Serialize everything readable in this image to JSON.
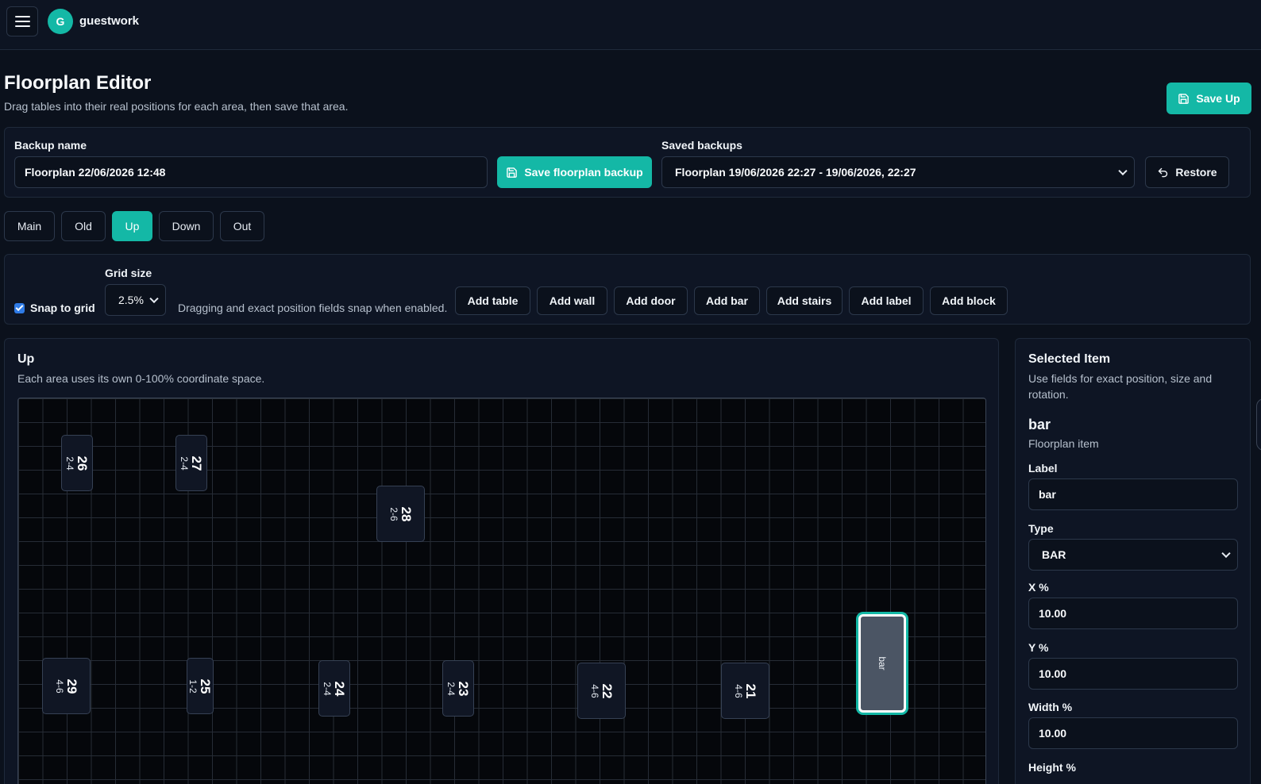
{
  "app": {
    "brand_initial": "G",
    "brand_name": "guestwork"
  },
  "header": {
    "title": "Floorplan Editor",
    "subtitle": "Drag tables into their real positions for each area, then save that area.",
    "save_area_label": "Save Up"
  },
  "backup": {
    "name_label": "Backup name",
    "name_value": "Floorplan 22/06/2026 12:48",
    "save_label": "Save floorplan backup",
    "saved_label": "Saved backups",
    "saved_selected": "Floorplan 19/06/2026 22:27 - 19/06/2026, 22:27",
    "restore_label": "Restore"
  },
  "areas": [
    {
      "label": "Main",
      "active": false
    },
    {
      "label": "Old",
      "active": false
    },
    {
      "label": "Up",
      "active": true
    },
    {
      "label": "Down",
      "active": false
    },
    {
      "label": "Out",
      "active": false
    }
  ],
  "toolbar": {
    "snap_label": "Snap to grid",
    "snap_checked": true,
    "grid_label": "Grid size",
    "grid_value": "2.5%",
    "hint": "Dragging and exact position fields snap when enabled.",
    "add_buttons": [
      "Add table",
      "Add wall",
      "Add door",
      "Add bar",
      "Add stairs",
      "Add label",
      "Add block"
    ]
  },
  "canvas_panel": {
    "title": "Up",
    "subtitle": "Each area uses its own 0-100% coordinate space."
  },
  "floor_items": [
    {
      "number": "26",
      "capacity": "2-4"
    },
    {
      "number": "27",
      "capacity": "2-4"
    },
    {
      "number": "28",
      "capacity": "2-6"
    },
    {
      "number": "29",
      "capacity": "4-6"
    },
    {
      "number": "25",
      "capacity": "1-2"
    },
    {
      "number": "24",
      "capacity": "2-4"
    },
    {
      "number": "23",
      "capacity": "2-4"
    },
    {
      "number": "22",
      "capacity": "4-6"
    },
    {
      "number": "21",
      "capacity": "4-6"
    }
  ],
  "bar_item": {
    "label": "bar"
  },
  "selected": {
    "title": "Selected Item",
    "subtitle": "Use fields for exact position, size and rotation.",
    "item_name": "bar",
    "item_kind": "Floorplan item",
    "label_field": "Label",
    "label_value": "bar",
    "type_field": "Type",
    "type_value": "BAR",
    "x_field": "X %",
    "x_value": "10.00",
    "y_field": "Y %",
    "y_value": "10.00",
    "w_field": "Width %",
    "w_value": "10.00",
    "h_field": "Height %"
  },
  "colors": {
    "accent": "#14b8a6",
    "background": "#0b111c",
    "panel": "#0e1524"
  }
}
